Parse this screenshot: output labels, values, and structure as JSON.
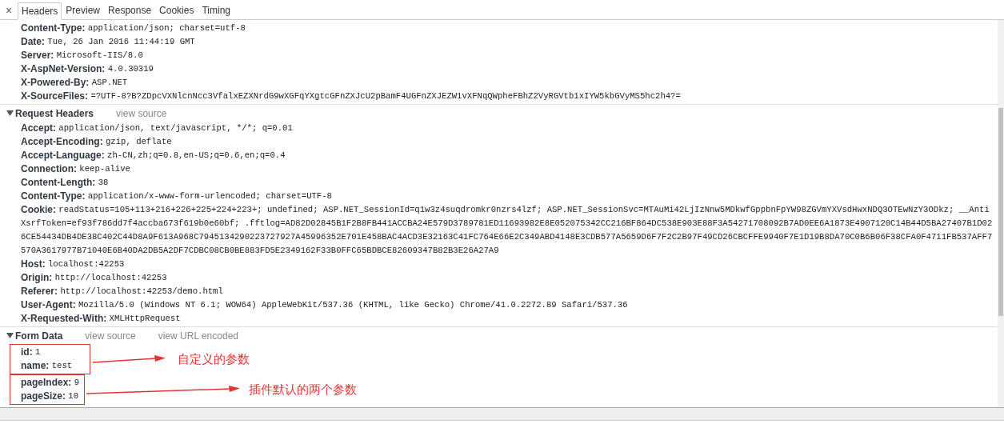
{
  "close_label": "×",
  "tabs": [
    {
      "label": "Headers",
      "selected": true
    },
    {
      "label": "Preview",
      "selected": false
    },
    {
      "label": "Response",
      "selected": false
    },
    {
      "label": "Cookies",
      "selected": false
    },
    {
      "label": "Timing",
      "selected": false
    }
  ],
  "response_headers": {
    "rows": [
      {
        "name": "Content-Type:",
        "value": "application/json; charset=utf-8"
      },
      {
        "name": "Date:",
        "value": "Tue, 26 Jan 2016 11:44:19 GMT"
      },
      {
        "name": "Server:",
        "value": "Microsoft-IIS/8.0"
      },
      {
        "name": "X-AspNet-Version:",
        "value": "4.0.30319"
      },
      {
        "name": "X-Powered-By:",
        "value": "ASP.NET"
      },
      {
        "name": "X-SourceFiles:",
        "value": "=?UTF-8?B?ZDpcVXNlcnNcc3VfalxEZXNrdG9wXGFqYXgtcGFnZXJcU2pBamF4UGFnZXJEZW1vXFNqQWpheFBhZ2VyRGVtb1xIYW5kbGVyMS5hc2h4?="
      }
    ]
  },
  "request_headers": {
    "title": "Request Headers",
    "expanded": true,
    "links": [
      "view source"
    ],
    "rows": [
      {
        "name": "Accept:",
        "value": "application/json, text/javascript, */*; q=0.01"
      },
      {
        "name": "Accept-Encoding:",
        "value": "gzip, deflate"
      },
      {
        "name": "Accept-Language:",
        "value": "zh-CN,zh;q=0.8,en-US;q=0.6,en;q=0.4"
      },
      {
        "name": "Connection:",
        "value": "keep-alive"
      },
      {
        "name": "Content-Length:",
        "value": "38"
      },
      {
        "name": "Content-Type:",
        "value": "application/x-www-form-urlencoded; charset=UTF-8"
      },
      {
        "name": "Cookie:",
        "value": "readStatus=105+113+216+226+225+224+223+; undefined; ASP.NET_SessionId=q1w3z4suqdromkr0nzrs4lzf; ASP.NET_SessionSvc=MTAuMi42LjIzNnw5MDkwfGppbnFpYW98ZGVmYXVsdHwxNDQ3OTEwNzY3ODkz; __AntiXsrfToken=ef93f786dd7f4accba673f619b0e60bf; .fftlog=AD82D02845B1F2B8FB441ACCBA24E579D3789781ED11693982E8E052075342CC216BF864DC538E903E88F3A54271708092B7AD0EE6A1873E4907120C14B44D5BA27407B1D026CE54434DB4DE38C402C44D8A9F613A968C7945134290223727927A45996352E701E458BAC4ACD3E32163C41FC764E66E2C349ABD4148E3CDB577A5659D6F7F2C2B97F49CD26CBCFFE9940F7E1D19B8DA70C0B6B06F38CFA0F4711FB537AFF7570A3617977B71040E6B40DA2DB5A2DF7CDBC08CB0BE883FD5E2349162F33B0FFC65BDBCE82609347B82B3E26A27A9"
      },
      {
        "name": "Host:",
        "value": "localhost:42253"
      },
      {
        "name": "Origin:",
        "value": "http://localhost:42253"
      },
      {
        "name": "Referer:",
        "value": "http://localhost:42253/demo.html"
      },
      {
        "name": "User-Agent:",
        "value": "Mozilla/5.0 (Windows NT 6.1; WOW64) AppleWebKit/537.36 (KHTML, like Gecko) Chrome/41.0.2272.89 Safari/537.36"
      },
      {
        "name": "X-Requested-With:",
        "value": "XMLHttpRequest"
      }
    ]
  },
  "form_data": {
    "title": "Form Data",
    "expanded": true,
    "links": [
      "view source",
      "view URL encoded"
    ],
    "groups": [
      {
        "note": "自定义的参数",
        "rows": [
          {
            "name": "id:",
            "value": "1"
          },
          {
            "name": "name:",
            "value": "test"
          }
        ]
      },
      {
        "note": "插件默认的两个参数",
        "rows": [
          {
            "name": "pageIndex:",
            "value": "9"
          },
          {
            "name": "pageSize:",
            "value": "10"
          }
        ]
      }
    ]
  }
}
